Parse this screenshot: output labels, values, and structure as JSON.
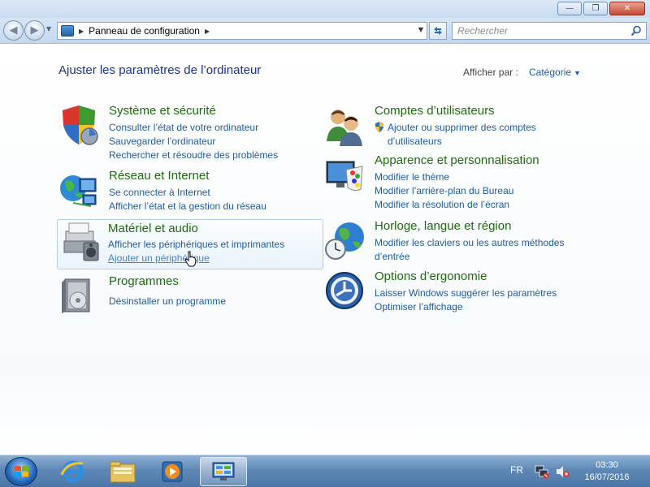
{
  "window": {
    "minimize_glyph": "—",
    "restore_glyph": "❐",
    "close_glyph": "✕"
  },
  "nav": {
    "back_glyph": "◀",
    "forward_glyph": "▶",
    "address_segments": [
      "Panneau de configuration"
    ],
    "search_placeholder": "Rechercher"
  },
  "content": {
    "heading": "Ajuster les paramètres de l’ordinateur",
    "view_by_label": "Afficher par :",
    "view_by_value": "Catégorie"
  },
  "categories": [
    {
      "title": "Système et sécurité",
      "icon": "shield-icon",
      "links": [
        "Consulter l’état de votre ordinateur",
        "Sauvegarder l’ordinateur",
        "Rechercher et résoudre des problèmes"
      ]
    },
    {
      "title": "Réseau et Internet",
      "icon": "network-globe-icon",
      "links": [
        "Se connecter à Internet",
        "Afficher l’état et la gestion du réseau"
      ]
    },
    {
      "title": "Matériel et audio",
      "icon": "printer-speaker-icon",
      "links": [
        "Afficher les périphériques et imprimantes",
        "Ajouter un périphérique"
      ]
    },
    {
      "title": "Programmes",
      "icon": "programs-box-icon",
      "links": [
        "Désinstaller un programme"
      ]
    },
    {
      "title": "Comptes d’utilisateurs",
      "icon": "users-icon",
      "links": [
        "Ajouter ou supprimer des comptes",
        "d’utilisateurs"
      ]
    },
    {
      "title": "Apparence et personnalisation",
      "icon": "monitor-palette-icon",
      "links": [
        "Modifier le thème",
        "Modifier l’arrière-plan du Bureau",
        "Modifier la résolution de l’écran"
      ]
    },
    {
      "title": "Horloge, langue et région",
      "icon": "globe-clock-icon",
      "links": [
        "Modifier les claviers ou les autres méthodes",
        "d’entrée"
      ]
    },
    {
      "title": "Options d’ergonomie",
      "icon": "ease-of-access-icon",
      "links": [
        "Laisser Windows suggérer les paramètres",
        "Optimiser l’affichage"
      ]
    }
  ],
  "taskbar": {
    "language": "FR",
    "time": "03:30",
    "date": "16/07/2016"
  },
  "colors": {
    "category_title": "#1f6b0e",
    "link": "#1e5ca6",
    "heading": "#1e3287"
  }
}
